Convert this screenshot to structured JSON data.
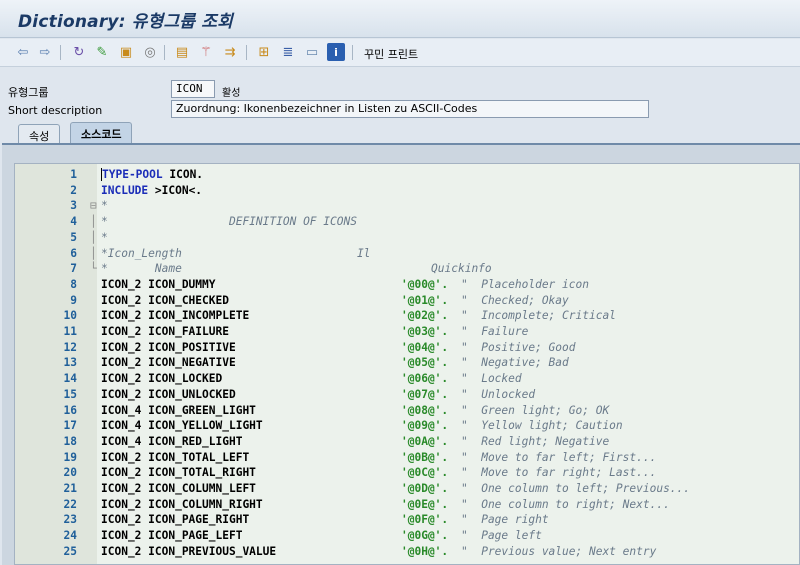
{
  "window": {
    "title": "Dictionary: 유형그룹 조회"
  },
  "toolbar": {
    "icons": [
      "back-arrow-icon",
      "forward-arrow-icon",
      "glasses-icon",
      "display-change-icon",
      "object-list-icon",
      "activate-icon",
      "other-object-icon",
      "wand-icon",
      "where-used-icon",
      "hierarchy-icon",
      "stack-icon",
      "window-icon",
      "info-icon"
    ],
    "pretty_print_label": "꾸민 프린트"
  },
  "form": {
    "type_group_label": "유형그룹",
    "type_group_value": "ICON",
    "status_text": "활성",
    "short_desc_label": "Short description",
    "short_desc_value": "Zuordnung: Ikonenbezeichner in Listen zu ASCII-Codes"
  },
  "tabs": [
    {
      "label": "속성"
    },
    {
      "label": "소스코드"
    }
  ],
  "editor": {
    "lines": [
      {
        "n": "1",
        "code": "TYPE-POOL ICON."
      },
      {
        "n": "2",
        "code": "INCLUDE >ICON<."
      },
      {
        "n": "3",
        "code": "*"
      },
      {
        "n": "4",
        "code": "*                  DEFINITION OF ICONS"
      },
      {
        "n": "5",
        "code": "*"
      },
      {
        "n": "6",
        "code": "*Icon_Length                          Il"
      },
      {
        "n": "7",
        "code": "*       Name                                     Quickinfo"
      },
      {
        "n": "8",
        "name": "ICON_2 ICON_DUMMY",
        "value": "'@00@'.",
        "comment": "\"  Placeholder icon"
      },
      {
        "n": "9",
        "name": "ICON_2 ICON_CHECKED",
        "value": "'@01@'.",
        "comment": "\"  Checked; Okay"
      },
      {
        "n": "10",
        "name": "ICON_2 ICON_INCOMPLETE",
        "value": "'@02@'.",
        "comment": "\"  Incomplete; Critical"
      },
      {
        "n": "11",
        "name": "ICON_2 ICON_FAILURE",
        "value": "'@03@'.",
        "comment": "\"  Failure"
      },
      {
        "n": "12",
        "name": "ICON_2 ICON_POSITIVE",
        "value": "'@04@'.",
        "comment": "\"  Positive; Good"
      },
      {
        "n": "13",
        "name": "ICON_2 ICON_NEGATIVE",
        "value": "'@05@'.",
        "comment": "\"  Negative; Bad"
      },
      {
        "n": "14",
        "name": "ICON_2 ICON_LOCKED",
        "value": "'@06@'.",
        "comment": "\"  Locked"
      },
      {
        "n": "15",
        "name": "ICON_2 ICON_UNLOCKED",
        "value": "'@07@'.",
        "comment": "\"  Unlocked"
      },
      {
        "n": "16",
        "name": "ICON_4 ICON_GREEN_LIGHT",
        "value": "'@08@'.",
        "comment": "\"  Green light; Go; OK"
      },
      {
        "n": "17",
        "name": "ICON_4 ICON_YELLOW_LIGHT",
        "value": "'@09@'.",
        "comment": "\"  Yellow light; Caution"
      },
      {
        "n": "18",
        "name": "ICON_4 ICON_RED_LIGHT",
        "value": "'@0A@'.",
        "comment": "\"  Red light; Negative"
      },
      {
        "n": "19",
        "name": "ICON_2 ICON_TOTAL_LEFT",
        "value": "'@0B@'.",
        "comment": "\"  Move to far left; First..."
      },
      {
        "n": "20",
        "name": "ICON_2 ICON_TOTAL_RIGHT",
        "value": "'@0C@'.",
        "comment": "\"  Move to far right; Last..."
      },
      {
        "n": "21",
        "name": "ICON_2 ICON_COLUMN_LEFT",
        "value": "'@0D@'.",
        "comment": "\"  One column to left; Previous..."
      },
      {
        "n": "22",
        "name": "ICON_2 ICON_COLUMN_RIGHT",
        "value": "'@0E@'.",
        "comment": "\"  One column to right; Next..."
      },
      {
        "n": "23",
        "name": "ICON_2 ICON_PAGE_RIGHT",
        "value": "'@0F@'.",
        "comment": "\"  Page right"
      },
      {
        "n": "24",
        "name": "ICON_2 ICON_PAGE_LEFT",
        "value": "'@0G@'.",
        "comment": "\"  Page left"
      },
      {
        "n": "25",
        "name": "ICON_2 ICON_PREVIOUS_VALUE",
        "value": "'@0H@'.",
        "comment": "\"  Previous value; Next entry"
      }
    ]
  }
}
